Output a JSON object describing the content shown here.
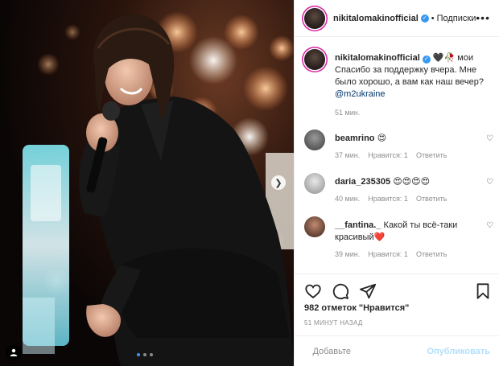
{
  "post": {
    "author": "nikitalomakinofficial",
    "follow_separator": "•",
    "follow_label": "Подписки",
    "more_icon": "more-dots-icon"
  },
  "caption": {
    "username": "nikitalomakinofficial",
    "emojis": "🖤🥀",
    "text": "мои Спасибо за поддержку вчера. Мне было хорошо, а вам как наш вечер?",
    "mention": "@m2ukraine",
    "time": "51 мин."
  },
  "comments": [
    {
      "username": "beamrino",
      "text": "😍",
      "time": "37 мин.",
      "likes": "Нравится: 1",
      "reply": "Ответить"
    },
    {
      "username": "daria_235305",
      "text": "😍😍😍😍",
      "time": "40 мин.",
      "likes": "Нравится: 1",
      "reply": "Ответить"
    },
    {
      "username": "__fantina._",
      "text": "Какой ты всё-таки красивый❤️",
      "time": "39 мин.",
      "likes": "Нравится: 1",
      "reply": "Ответить"
    }
  ],
  "footer": {
    "likes": "982 отметок \"Нравится\"",
    "posted": "51 МИНУТ НАЗАД",
    "add_placeholder": "Добавьте",
    "publish_label": "Опубликовать"
  },
  "carousel": {
    "slides": 3,
    "current": 1
  },
  "colors": {
    "accent": "#3897f0",
    "story_ring": "#d6249f",
    "publish_disabled": "#b2dffc"
  }
}
